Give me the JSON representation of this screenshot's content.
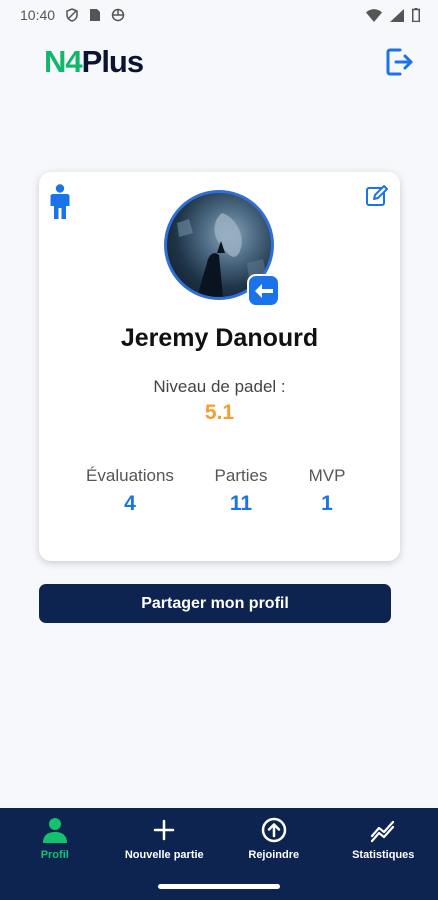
{
  "status_bar": {
    "time": "10:40",
    "icons_left": [
      "shield-icon",
      "sim-card-icon",
      "vpn-icon"
    ],
    "icons_right": [
      "wifi-icon",
      "signal-icon",
      "battery-icon"
    ]
  },
  "header": {
    "logo_prefix": "N4",
    "logo_suffix": "Plus",
    "logout_icon": "logout-icon"
  },
  "profile": {
    "name": "Jeremy Danourd",
    "level_label": "Niveau de padel :",
    "level_value": "5.1",
    "stats": [
      {
        "label": "Évaluations",
        "value": "4"
      },
      {
        "label": "Parties",
        "value": "11"
      },
      {
        "label": "MVP",
        "value": "1"
      }
    ],
    "share_button": "Partager mon profil"
  },
  "nav": {
    "items": [
      {
        "label": "Profil",
        "icon": "person-icon",
        "active": true
      },
      {
        "label": "Nouvelle partie",
        "icon": "plus-icon",
        "active": false
      },
      {
        "label": "Rejoindre",
        "icon": "arrow-up-circle-icon",
        "active": false
      },
      {
        "label": "Statistiques",
        "icon": "trend-icon",
        "active": false
      }
    ]
  },
  "colors": {
    "brand_green": "#12b76a",
    "navy": "#0d2451",
    "accent_blue": "#1a73e8",
    "level_orange": "#f0a030"
  }
}
